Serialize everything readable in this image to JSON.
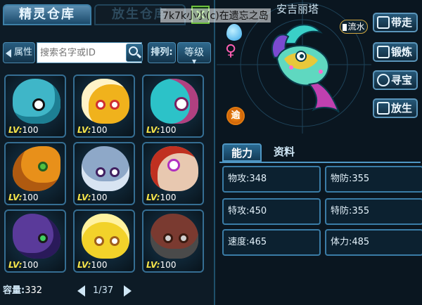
{
  "warehouse": {
    "tab_active": "精灵仓库",
    "tab_inactive": "放生仓库",
    "chat_line": "7k7k小小(c)在遗忘之岛"
  },
  "filter": {
    "attribute_label": "属性",
    "search_placeholder": "搜索名字或ID",
    "sort_label": "排列:",
    "sort_value": "等级"
  },
  "slots": [
    {
      "lv_label": "LV:",
      "level": "100",
      "color": "#3fb6c8"
    },
    {
      "lv_label": "LV:",
      "level": "100",
      "color": "#f0b21c"
    },
    {
      "lv_label": "LV:",
      "level": "100",
      "color": "#2cc2c8"
    },
    {
      "lv_label": "LV:",
      "level": "100",
      "color": "#e8901a"
    },
    {
      "lv_label": "LV:",
      "level": "100",
      "color": "#8ea8c8"
    },
    {
      "lv_label": "LV:",
      "level": "100",
      "color": "#e8c8b0"
    },
    {
      "lv_label": "LV:",
      "level": "100",
      "color": "#5a3a9a"
    },
    {
      "lv_label": "LV:",
      "level": "100",
      "color": "#f2d22a"
    },
    {
      "lv_label": "LV:",
      "level": "100",
      "color": "#7a3a30"
    }
  ],
  "footer": {
    "capacity_label": "容量:",
    "capacity_value": "332",
    "page": "1/37"
  },
  "detail": {
    "name": "安吉丽塔",
    "element": "流水",
    "badge": "逾"
  },
  "actions": {
    "carry": "带走",
    "train": "锻炼",
    "treasure": "寻宝",
    "release": "放生"
  },
  "stat_tabs": {
    "ability": "能力",
    "info": "资料"
  },
  "stats": {
    "atk": "物攻:348",
    "def": "物防:355",
    "spatk": "特攻:450",
    "spdef": "特防:355",
    "speed": "速度:465",
    "hp": "体力:485"
  }
}
